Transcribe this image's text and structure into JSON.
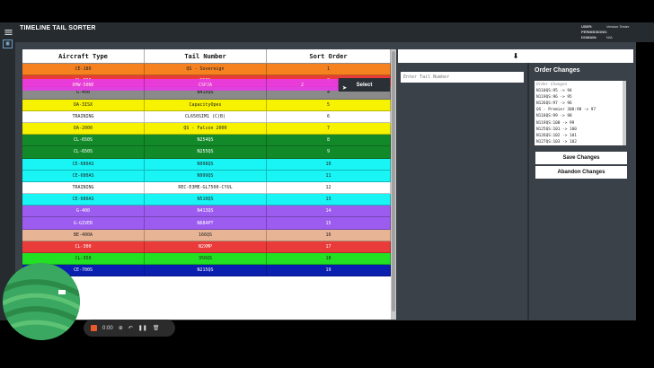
{
  "app": {
    "title": "TIMELINE TAIL SORTER"
  },
  "meta": [
    {
      "key": "USER:",
      "value": "Version Tester"
    },
    {
      "key": "PERMISSIONS:",
      "value": ""
    },
    {
      "key": "DOMAIN:",
      "value": "N/A"
    }
  ],
  "table": {
    "headers": [
      "Aircraft Type",
      "Tail Number",
      "Sort Order"
    ],
    "rows": [
      {
        "type": "CE-180",
        "tail": "QS - Sovereign",
        "order": "1",
        "bg": "#f5811f",
        "fg": "#222"
      },
      {
        "type": "CL-300",
        "tail": "N1QS",
        "order": "2",
        "bg": "#ea3b3b",
        "fg": "#fff"
      },
      {
        "type": "G-450",
        "tail": "N415QS",
        "order": "4",
        "bg": "#8a8a8a",
        "fg": "#111"
      },
      {
        "type": "DA-3ISX",
        "tail": "CapacityOpes",
        "order": "5",
        "bg": "#f7f300",
        "fg": "#222"
      },
      {
        "type": "TRAINING",
        "tail": "CL650SIM1 (C(B)",
        "order": "6",
        "bg": "#ffffff",
        "fg": "#222"
      },
      {
        "type": "DA-2000",
        "tail": "QS - Falcon 2000",
        "order": "7",
        "bg": "#f7f300",
        "fg": "#222"
      },
      {
        "type": "CL-650S",
        "tail": "N254QS",
        "order": "8",
        "bg": "#138a2a",
        "fg": "#fff"
      },
      {
        "type": "CL-650S",
        "tail": "N255QS",
        "order": "9",
        "bg": "#138a2a",
        "fg": "#fff"
      },
      {
        "type": "CE-680AS",
        "tail": "N998QS",
        "order": "10",
        "bg": "#19f5f5",
        "fg": "#222"
      },
      {
        "type": "CE-680AS",
        "tail": "N999QS",
        "order": "11",
        "bg": "#19f5f5",
        "fg": "#222"
      },
      {
        "type": "TRAINING",
        "tail": "REC-E3ME-GL7500-CYUL",
        "order": "12",
        "bg": "#ffffff",
        "fg": "#222"
      },
      {
        "type": "CE-680AS",
        "tail": "N510QS",
        "order": "13",
        "bg": "#19f5f5",
        "fg": "#222"
      },
      {
        "type": "G-400",
        "tail": "N413QS",
        "order": "14",
        "bg": "#9c5cf0",
        "fg": "#fff"
      },
      {
        "type": "G-GIVER",
        "tail": "N684PT",
        "order": "15",
        "bg": "#9c5cf0",
        "fg": "#fff"
      },
      {
        "type": "BE-400A",
        "tail": "166QS",
        "order": "16",
        "bg": "#e8b496",
        "fg": "#222"
      },
      {
        "type": "CL-300",
        "tail": "N2XMP",
        "order": "17",
        "bg": "#ea3b3b",
        "fg": "#fff"
      },
      {
        "type": "CL-350",
        "tail": "356QS",
        "order": "18",
        "bg": "#22e022",
        "fg": "#222"
      },
      {
        "type": "CE-700S",
        "tail": "N215QS",
        "order": "19",
        "bg": "#0a1fb0",
        "fg": "#fff"
      }
    ]
  },
  "drag_row": {
    "type": "DHW-50NE",
    "tail": "CSPJA",
    "order": "2"
  },
  "select_label": "Select",
  "panel": {
    "down_arrow": "⬇",
    "tail_placeholder": "Enter Tail Number"
  },
  "order_changes": {
    "title": "Order Changes",
    "placeholder": "Order Changes",
    "lines": [
      "N110QS:95 -> 94",
      "N119QS:96 -> 95",
      "N126QS:97 -> 96",
      "QS - Premier 300:98 -> 97",
      "N118QS:99 -> 98",
      "N119QS:100 -> 99",
      "N125QS:101 -> 100",
      "N126QS:102 -> 101",
      "N127QS:103 -> 102"
    ],
    "save_label": "Save Changes",
    "abandon_label": "Abandon Changes"
  },
  "recorder": {
    "time": "0:00"
  }
}
